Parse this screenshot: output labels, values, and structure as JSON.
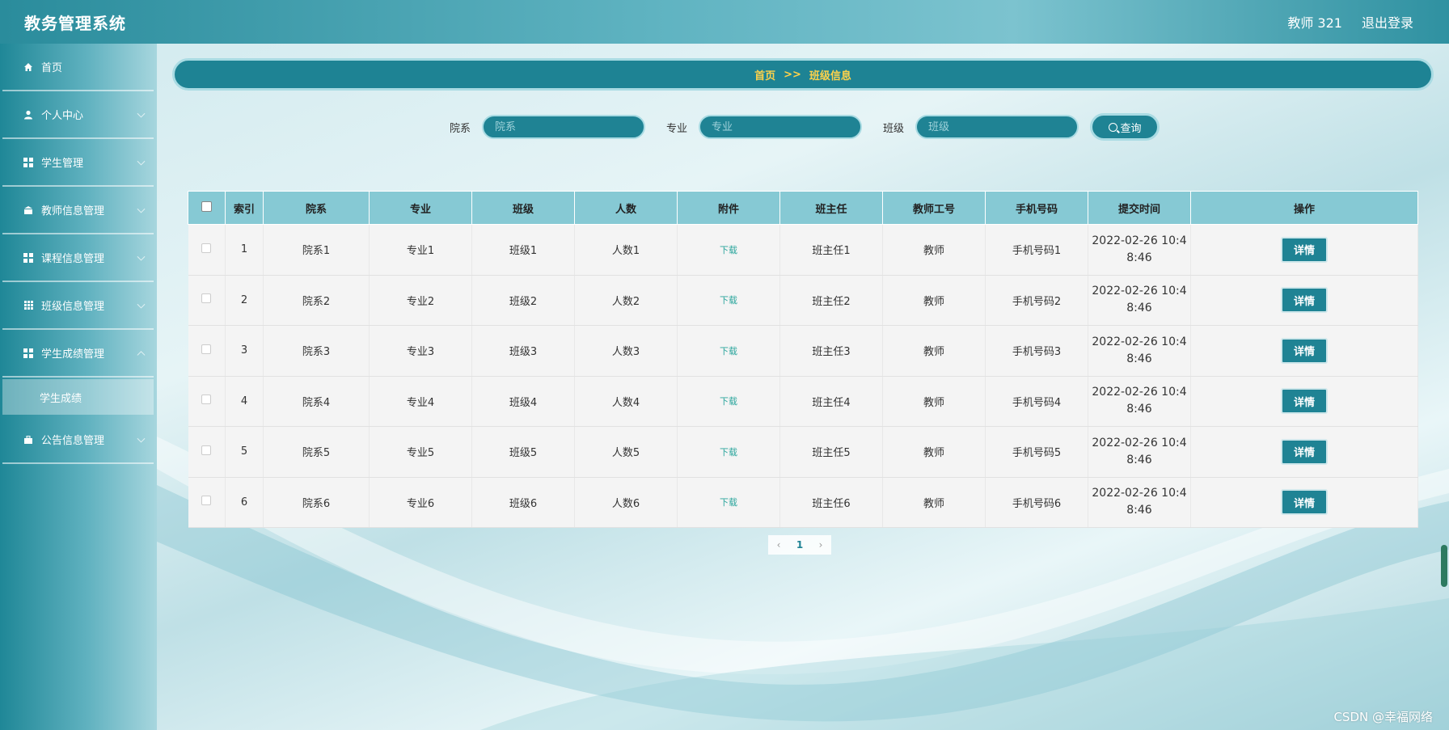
{
  "header": {
    "app_title": "教务管理系统",
    "user": "教师 321",
    "logout": "退出登录"
  },
  "sidebar": {
    "items": [
      {
        "label": "首页",
        "icon": "home-icon"
      },
      {
        "label": "个人中心",
        "icon": "user-icon"
      },
      {
        "label": "学生管理",
        "icon": "grid-icon"
      },
      {
        "label": "教师信息管理",
        "icon": "teacher-icon"
      },
      {
        "label": "课程信息管理",
        "icon": "grid-icon"
      },
      {
        "label": "班级信息管理",
        "icon": "grid9-icon"
      },
      {
        "label": "学生成绩管理",
        "icon": "grid-icon"
      },
      {
        "label": "公告信息管理",
        "icon": "briefcase-icon"
      }
    ],
    "subitem": "学生成绩"
  },
  "breadcrumb": {
    "home": "首页",
    "sep": ">>",
    "current": "班级信息"
  },
  "search": {
    "dept_label": "院系",
    "dept_placeholder": "院系",
    "major_label": "专业",
    "major_placeholder": "专业",
    "class_label": "班级",
    "class_placeholder": "班级",
    "button": "查询"
  },
  "table": {
    "headers": [
      "索引",
      "院系",
      "专业",
      "班级",
      "人数",
      "附件",
      "班主任",
      "教师工号",
      "手机号码",
      "提交时间",
      "操作"
    ],
    "rows": [
      {
        "index": "1",
        "dept": "院系1",
        "major": "专业1",
        "cls": "班级1",
        "count": "人数1",
        "attach": "下载",
        "head": "班主任1",
        "tid": "教师",
        "phone": "手机号码1",
        "time1": "2022-02-26 10:4",
        "time2": "8:46",
        "action": "详情"
      },
      {
        "index": "2",
        "dept": "院系2",
        "major": "专业2",
        "cls": "班级2",
        "count": "人数2",
        "attach": "下载",
        "head": "班主任2",
        "tid": "教师",
        "phone": "手机号码2",
        "time1": "2022-02-26 10:4",
        "time2": "8:46",
        "action": "详情"
      },
      {
        "index": "3",
        "dept": "院系3",
        "major": "专业3",
        "cls": "班级3",
        "count": "人数3",
        "attach": "下载",
        "head": "班主任3",
        "tid": "教师",
        "phone": "手机号码3",
        "time1": "2022-02-26 10:4",
        "time2": "8:46",
        "action": "详情"
      },
      {
        "index": "4",
        "dept": "院系4",
        "major": "专业4",
        "cls": "班级4",
        "count": "人数4",
        "attach": "下载",
        "head": "班主任4",
        "tid": "教师",
        "phone": "手机号码4",
        "time1": "2022-02-26 10:4",
        "time2": "8:46",
        "action": "详情"
      },
      {
        "index": "5",
        "dept": "院系5",
        "major": "专业5",
        "cls": "班级5",
        "count": "人数5",
        "attach": "下载",
        "head": "班主任5",
        "tid": "教师",
        "phone": "手机号码5",
        "time1": "2022-02-26 10:4",
        "time2": "8:46",
        "action": "详情"
      },
      {
        "index": "6",
        "dept": "院系6",
        "major": "专业6",
        "cls": "班级6",
        "count": "人数6",
        "attach": "下载",
        "head": "班主任6",
        "tid": "教师",
        "phone": "手机号码6",
        "time1": "2022-02-26 10:4",
        "time2": "8:46",
        "action": "详情"
      }
    ]
  },
  "pagination": {
    "prev": "‹",
    "page": "1",
    "next": "›"
  },
  "watermark": "CSDN @幸福网络",
  "colors": {
    "primary": "#1f8394",
    "header_bg": "#86c9d4",
    "breadcrumb_text": "#ffd24a",
    "download_link": "#2aa59c"
  }
}
